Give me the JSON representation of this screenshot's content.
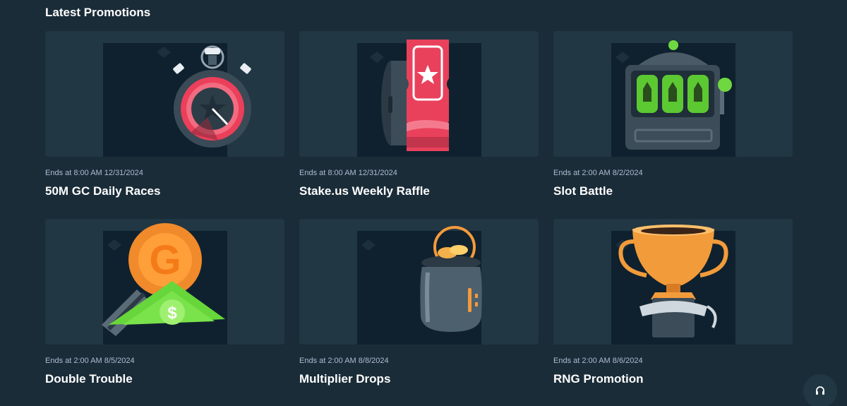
{
  "section": {
    "title": "Latest Promotions"
  },
  "promotions": [
    {
      "ends": "Ends at 8:00 AM 12/31/2024",
      "title": "50M GC Daily Races",
      "icon": "stopwatch-icon"
    },
    {
      "ends": "Ends at 8:00 AM 12/31/2024",
      "title": "Stake.us Weekly Raffle",
      "icon": "raffle-ticket-icon"
    },
    {
      "ends": "Ends at 2:00 AM 8/2/2024",
      "title": "Slot Battle",
      "icon": "slot-machine-icon"
    },
    {
      "ends": "Ends at 2:00 AM 8/5/2024",
      "title": "Double Trouble",
      "icon": "coin-and-cash-icon"
    },
    {
      "ends": "Ends at 2:00 AM 8/8/2024",
      "title": "Multiplier Drops",
      "icon": "coin-jar-icon"
    },
    {
      "ends": "Ends at 2:00 AM 8/6/2024",
      "title": "RNG Promotion",
      "icon": "trophy-icon"
    }
  ],
  "support": {
    "icon": "headset-icon"
  }
}
